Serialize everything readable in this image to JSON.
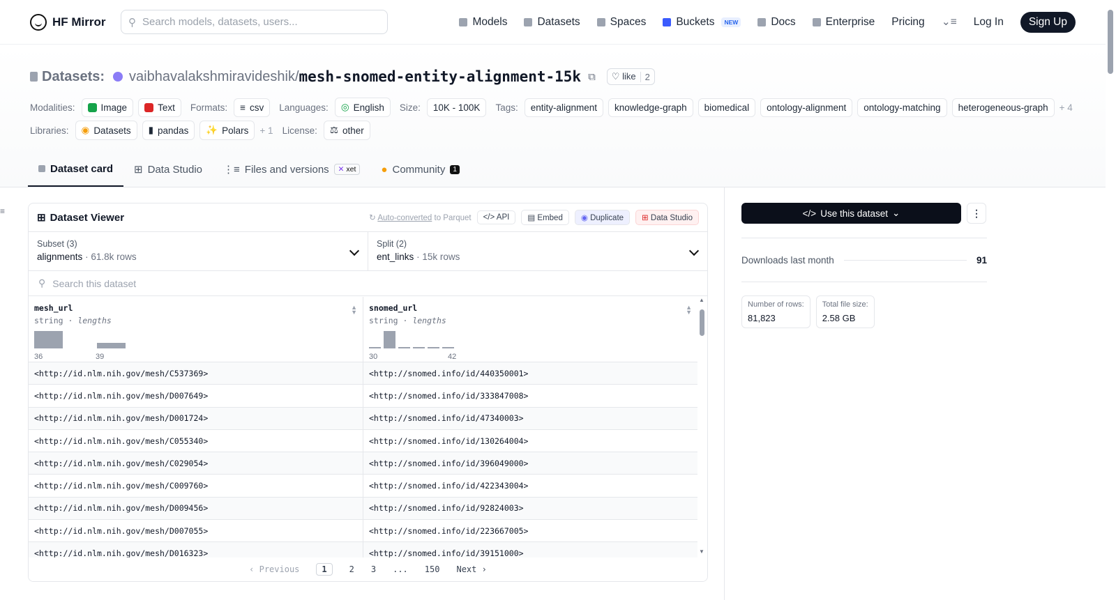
{
  "nav": {
    "brand": "HF Mirror",
    "search_placeholder": "Search models, datasets, users...",
    "links": [
      "Models",
      "Datasets",
      "Spaces",
      "Buckets",
      "Docs",
      "Enterprise",
      "Pricing"
    ],
    "new_badge": "NEW",
    "login": "Log In",
    "signup": "Sign Up"
  },
  "header": {
    "prefix": "Datasets:",
    "owner": "vaibhavalakshmiravideshik",
    "sep": "/",
    "name": "mesh-snomed-entity-alignment-15k",
    "like_label": "like",
    "like_count": "2",
    "modalities_label": "Modalities:",
    "modalities": [
      "Image",
      "Text"
    ],
    "formats_label": "Formats:",
    "format": "csv",
    "languages_label": "Languages:",
    "language": "English",
    "size_label": "Size:",
    "size": "10K - 100K",
    "tags_label": "Tags:",
    "tags": [
      "entity-alignment",
      "knowledge-graph",
      "biomedical",
      "ontology-alignment",
      "ontology-matching",
      "heterogeneous-graph"
    ],
    "tags_more": "+ 4",
    "libraries_label": "Libraries:",
    "libraries": [
      "Datasets",
      "pandas",
      "Polars"
    ],
    "libraries_more": "+ 1",
    "license_label": "License:",
    "license": "other"
  },
  "tabs": {
    "card": "Dataset card",
    "studio": "Data Studio",
    "files": "Files and versions",
    "xet": "xet",
    "community": "Community",
    "community_count": "1"
  },
  "viewer": {
    "title": "Dataset Viewer",
    "auto_link": "Auto-converted",
    "auto_rest": " to Parquet",
    "api": "API",
    "embed": "Embed",
    "duplicate": "Duplicate",
    "data_studio": "Data Studio",
    "subset_label": "Subset (3)",
    "subset_value": "alignments",
    "subset_rows": "61.8k rows",
    "split_label": "Split (2)",
    "split_value": "ent_links",
    "split_rows": "15k rows",
    "search_placeholder": "Search this dataset",
    "columns": [
      {
        "name": "mesh_url",
        "type": "string",
        "stat": "lengths",
        "min": "36",
        "max": "39"
      },
      {
        "name": "snomed_url",
        "type": "string",
        "stat": "lengths",
        "min": "30",
        "max": "42"
      }
    ],
    "rows": [
      [
        "<http://id.nlm.nih.gov/mesh/C537369>",
        "<http://snomed.info/id/440350001>"
      ],
      [
        "<http://id.nlm.nih.gov/mesh/D007649>",
        "<http://snomed.info/id/333847008>"
      ],
      [
        "<http://id.nlm.nih.gov/mesh/D001724>",
        "<http://snomed.info/id/47340003>"
      ],
      [
        "<http://id.nlm.nih.gov/mesh/C055340>",
        "<http://snomed.info/id/130264004>"
      ],
      [
        "<http://id.nlm.nih.gov/mesh/C029054>",
        "<http://snomed.info/id/396049000>"
      ],
      [
        "<http://id.nlm.nih.gov/mesh/C009760>",
        "<http://snomed.info/id/422343004>"
      ],
      [
        "<http://id.nlm.nih.gov/mesh/D009456>",
        "<http://snomed.info/id/92824003>"
      ],
      [
        "<http://id.nlm.nih.gov/mesh/D007055>",
        "<http://snomed.info/id/223667005>"
      ],
      [
        "<http://id.nlm.nih.gov/mesh/D016323>",
        "<http://snomed.info/id/39151000>"
      ]
    ],
    "pager": {
      "prev": "Previous",
      "pages": [
        "1",
        "2",
        "3",
        "...",
        "150"
      ],
      "next": "Next"
    }
  },
  "side": {
    "use_button": "Use this dataset",
    "downloads_label": "Downloads last month",
    "downloads_value": "91",
    "rows_label": "Number of rows:",
    "rows_value": "81,823",
    "size_label": "Total file size:",
    "size_value": "2.58 GB"
  },
  "colors": {
    "primary": "#111827",
    "accent": "#2563eb",
    "muted": "#6b7280"
  }
}
